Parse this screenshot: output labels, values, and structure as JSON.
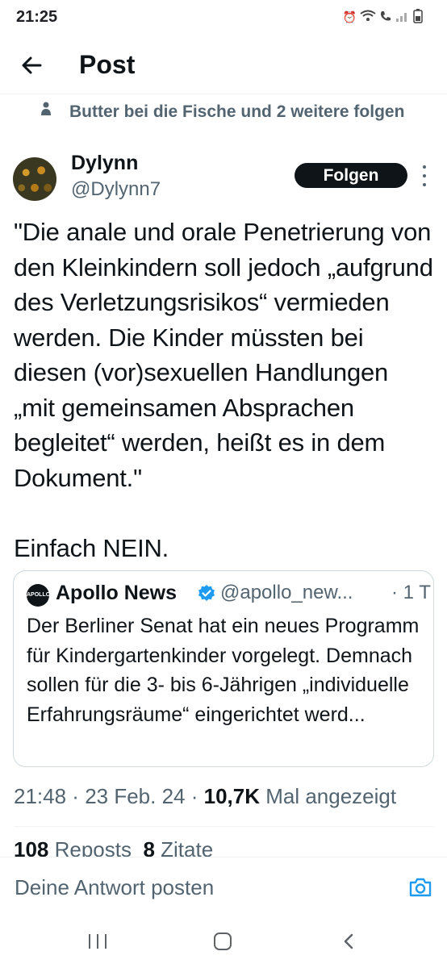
{
  "status": {
    "time": "21:25",
    "icons": [
      "alarm-icon",
      "wifi-icon",
      "call-icon",
      "signal-icon",
      "battery-icon"
    ]
  },
  "header": {
    "title": "Post"
  },
  "social_context": {
    "text": "Butter bei die Fische und 2 weitere folgen"
  },
  "author": {
    "name": "Dylynn",
    "handle": "@Dylynn7",
    "follow_label": "Folgen"
  },
  "post": {
    "text": "\"Die anale und orale Penetrierung von den Kleinkindern soll jedoch „aufgrund des Verletzungsrisikos“ vermieden werden. Die Kinder müssten bei diesen (vor)sexuellen Handlungen „mit gemeinsamen Absprachen begleitet“ werden, heißt es in dem Dokument.\"\n\nEinfach NEIN."
  },
  "quote": {
    "logo_text": "APOLLO",
    "name": "Apollo News",
    "handle": "@apollo_new...",
    "time": "· 1 T",
    "text": "Der Berliner Senat hat ein neues Programm für Kindergartenkinder vorgelegt. Demnach sollen für die 3- bis 6-Jährigen „individuelle Erfahrungsräume“ eingerichtet werd..."
  },
  "meta": {
    "time": "21:48",
    "sep1": " · ",
    "date": "23 Feb. 24",
    "sep2": " · ",
    "views": "10,7K",
    "views_label": " Mal angezeigt"
  },
  "stats": {
    "reposts": "108",
    "reposts_label": " Reposts",
    "quotes": "8",
    "quotes_label": " Zitate"
  },
  "reply": {
    "placeholder": "Deine Antwort posten"
  },
  "colors": {
    "text": "#0f1419",
    "secondary": "#536471",
    "accent": "#1d9bf0",
    "border": "#cfd9de"
  }
}
